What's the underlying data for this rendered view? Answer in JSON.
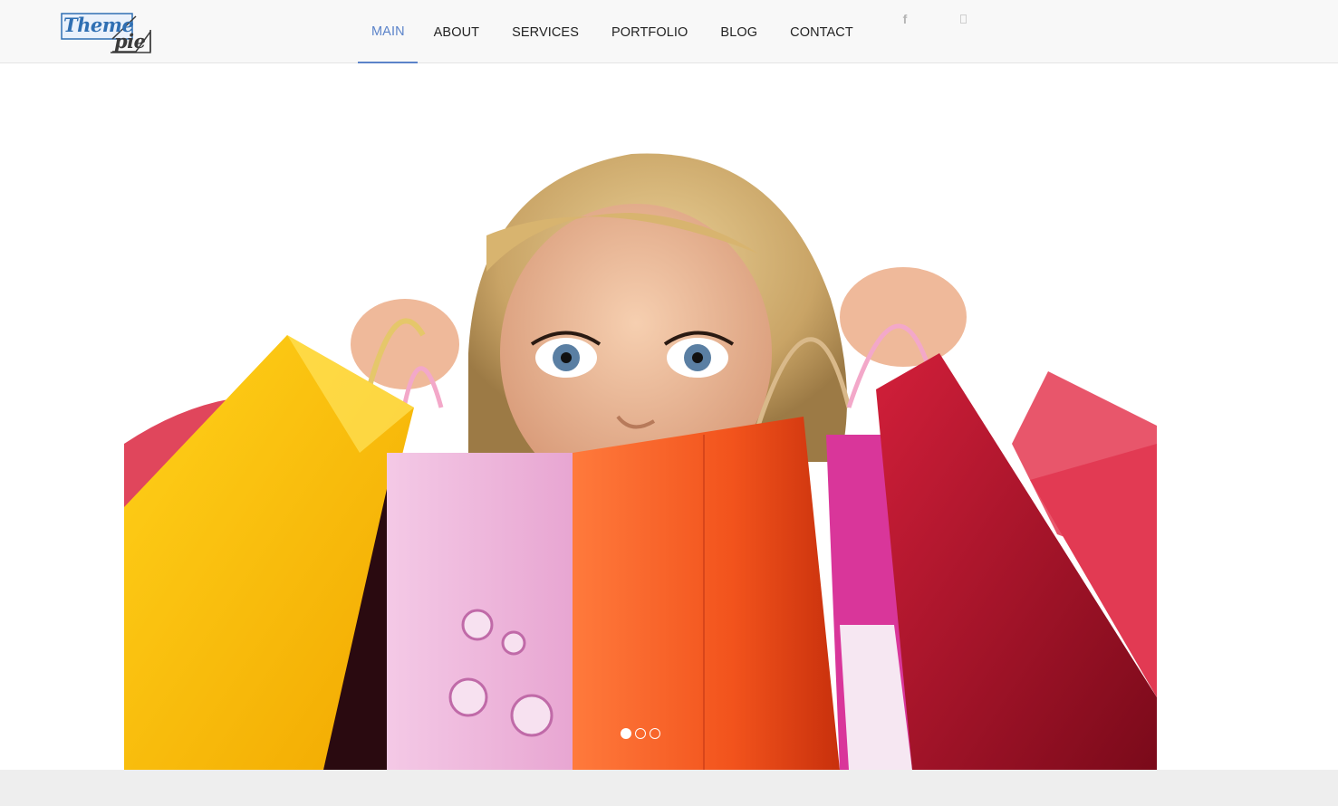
{
  "logo": {
    "line1": "Theme",
    "line2": "pie"
  },
  "nav": {
    "items": [
      {
        "label": "MAIN",
        "active": true
      },
      {
        "label": "ABOUT",
        "active": false
      },
      {
        "label": "SERVICES",
        "active": false
      },
      {
        "label": "PORTFOLIO",
        "active": false
      },
      {
        "label": "BLOG",
        "active": false
      },
      {
        "label": "CONTACT",
        "active": false
      }
    ]
  },
  "social": {
    "facebook_glyph": "f",
    "icons": [
      "facebook-icon",
      "missing-glyph-icon"
    ]
  },
  "hero": {
    "image": "woman-with-shopping-bags",
    "slides_total": 3,
    "active_slide": 1
  },
  "colors": {
    "accent": "#5b83c9",
    "header_bg": "#f8f8f8",
    "footer_bg": "#eeeeee"
  }
}
